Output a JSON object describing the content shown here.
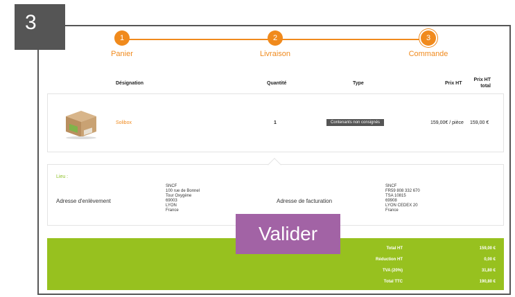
{
  "step_badge": "3",
  "stepper": {
    "steps": [
      {
        "number": "1",
        "label": "Panier"
      },
      {
        "number": "2",
        "label": "Livraison"
      },
      {
        "number": "3",
        "label": "Commande"
      }
    ],
    "color": "#f08a1d"
  },
  "table": {
    "headers": {
      "designation": "Désignation",
      "quantite": "Quantité",
      "type": "Type",
      "prix_ht": "Prix HT",
      "prix_ht_total": "Prix HT total"
    },
    "product": {
      "image_icon": "box-product-icon",
      "name": "Solibox",
      "quantity": "1",
      "type": "Contenants non consignés",
      "unit_price": "159,00€ / pièce",
      "total_price": "159,00 €"
    }
  },
  "address": {
    "lieu_label": "Lieu :",
    "pickup": {
      "label": "Adresse d'enlèvement",
      "lines": [
        "SNCF",
        "100 rue de Bonnel",
        "Tour Oxygène",
        "69003",
        "LYON",
        "France"
      ]
    },
    "billing": {
      "label": "Adresse de facturation",
      "lines": [
        "SNCF",
        "FR59 808 332 670",
        "TSA 10815",
        "69908",
        "LYON CEDEX 20",
        "France"
      ]
    }
  },
  "totals": {
    "rows": [
      {
        "label": "Total HT",
        "value": "159,00 €"
      },
      {
        "label": "Réduction HT",
        "value": "0,00 €"
      },
      {
        "label": "TVA (20%)",
        "value": "31,80 €"
      },
      {
        "label": "Total TTC",
        "value": "190,80 €"
      }
    ],
    "background": "#97c11f"
  },
  "valider_label": "Valider"
}
